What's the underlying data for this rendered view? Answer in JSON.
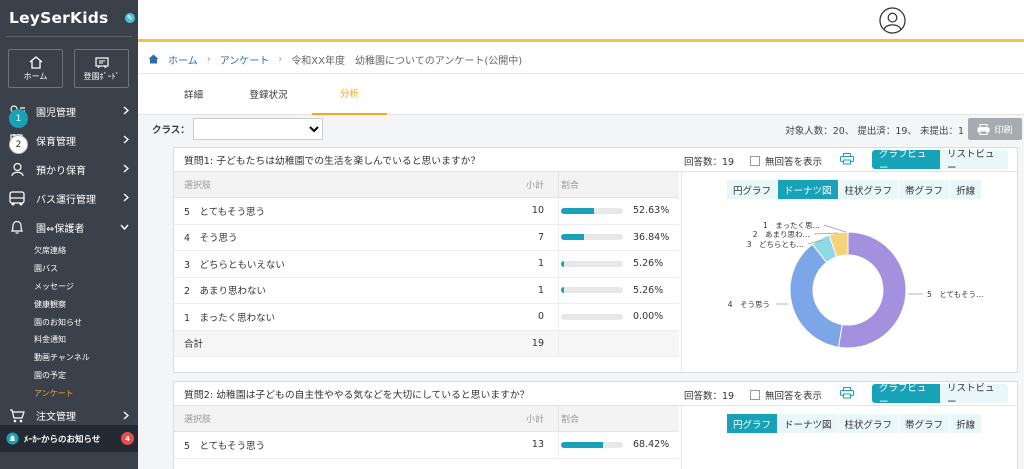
{
  "brand": "LeySerKids",
  "sidebar": {
    "quick": [
      {
        "label": "ホーム",
        "icon": "home-icon"
      },
      {
        "label": "登園ﾎﾞｰﾄﾞ",
        "icon": "board-icon"
      }
    ],
    "items": [
      {
        "label": "園児管理",
        "icon": "children-icon"
      },
      {
        "label": "保育管理",
        "icon": "childcare-icon"
      },
      {
        "label": "預かり保育",
        "icon": "daycare-icon"
      },
      {
        "label": "バス運行管理",
        "icon": "bus-icon"
      },
      {
        "label": "園⇔保護者",
        "icon": "bell-icon"
      }
    ],
    "subitems": [
      "欠席連絡",
      "園バス",
      "メッセージ",
      "健康観察",
      "園のお知らせ",
      "料金通知",
      "動画チャンネル",
      "園の予定",
      "アンケート"
    ],
    "order": {
      "label": "注文管理"
    },
    "notice": {
      "label": "ﾒｰｶｰからのお知らせ",
      "count": "4"
    }
  },
  "breadcrumb": {
    "home": "ホーム",
    "survey": "アンケート",
    "current": "令和XX年度　幼稚園についてのアンケート(公開中)"
  },
  "tabs": [
    "詳細",
    "登録状況",
    "分析"
  ],
  "filter": {
    "label": "クラス：",
    "counts": "対象人数：20、 提出済：19、 未提出：1",
    "print": "印刷"
  },
  "qnums": [
    "1",
    "2"
  ],
  "headers": {
    "choice": "選択肢",
    "subtotal": "小計",
    "ratio": "割合"
  },
  "q1": {
    "title": "質問1: 子どもたちは幼稚園での生活を楽しんでいると思いますか？",
    "answers": "回答数：19",
    "no_answer": "無回答を表示",
    "graph_view": "グラフビュー",
    "list_view": "リストビュー",
    "rows": [
      {
        "label": "5　とてもそう思う",
        "count": "10",
        "pct": "52.63%",
        "ratio": 0.5263
      },
      {
        "label": "4　そう思う",
        "count": "7",
        "pct": "36.84%",
        "ratio": 0.3684
      },
      {
        "label": "3　どちらともいえない",
        "count": "1",
        "pct": "5.26%",
        "ratio": 0.0526
      },
      {
        "label": "2　あまり思わない",
        "count": "1",
        "pct": "5.26%",
        "ratio": 0.0526
      },
      {
        "label": "1　まったく思わない",
        "count": "0",
        "pct": "0.00%",
        "ratio": 0
      }
    ],
    "total_label": "合計",
    "total": "19",
    "chart_tabs": [
      "円グラフ",
      "ドーナツ図",
      "柱状グラフ",
      "帯グラフ",
      "折線"
    ]
  },
  "q2": {
    "title": "質問2: 幼稚園は子どもの自主性ややる気などを大切にしていると思いますか？",
    "answers": "回答数：19",
    "no_answer": "無回答を表示",
    "graph_view": "グラフビュー",
    "list_view": "リストビュー",
    "rows": [
      {
        "label": "5　とてもそう思う",
        "count": "13",
        "pct": "68.42%",
        "ratio": 0.6842
      }
    ],
    "chart_tabs": [
      "円グラフ",
      "ドーナツ図",
      "柱状グラフ",
      "帯グラフ",
      "折線"
    ]
  },
  "chart_data": {
    "type": "pie",
    "categories": [
      "5　とてもそう…",
      "4　そう思う",
      "3　どちらとも…",
      "2　あまり思わ…",
      "1　まったく思…"
    ],
    "values": [
      10,
      7,
      1,
      1,
      0
    ],
    "colors": [
      "#a391e0",
      "#7da6e8",
      "#8fd8e8",
      "#f6d27a",
      "#f0b86a"
    ],
    "donut": true
  },
  "colors": {
    "accent": "#17a2b8",
    "active": "#f6a623",
    "sidebar": "#3a414b"
  }
}
